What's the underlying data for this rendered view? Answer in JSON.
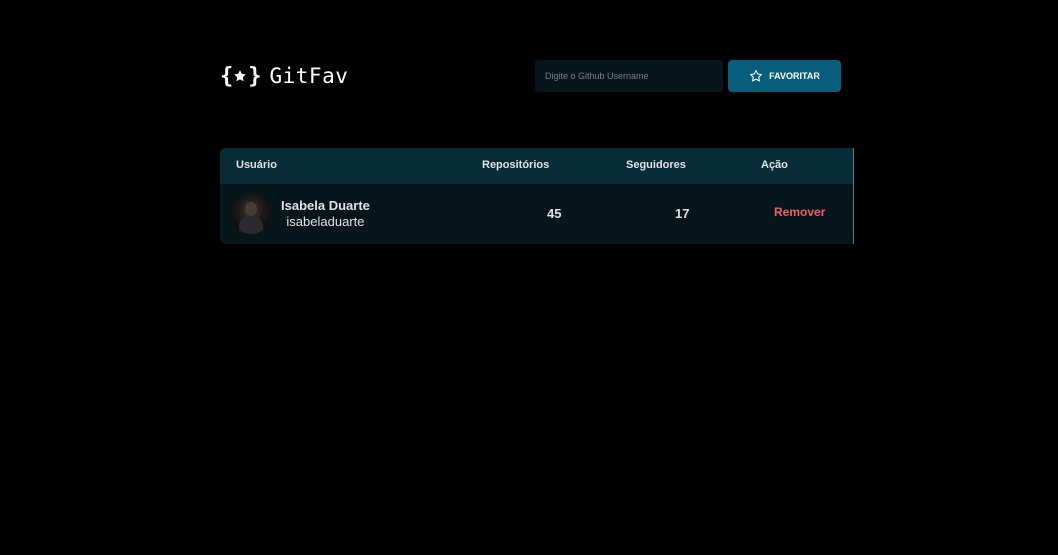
{
  "header": {
    "logo_text": "GitFav",
    "logo_icon": "braces-star-icon"
  },
  "search": {
    "placeholder": "Digite o Github Username",
    "value": "",
    "button_label": "FAVORITAR",
    "button_icon": "star-outline-icon"
  },
  "table": {
    "columns": [
      "Usuário",
      "Repositórios",
      "Seguidores",
      "Ação"
    ],
    "rows": [
      {
        "name": "Isabela Duarte",
        "login": "isabeladuarte",
        "repositories": "45",
        "followers": "17",
        "action_label": "Remover"
      }
    ]
  },
  "colors": {
    "background": "#000000",
    "header_row": "#092d38",
    "body_row": "#06161b",
    "button": "#065e7c",
    "remove": "#f75a68"
  }
}
